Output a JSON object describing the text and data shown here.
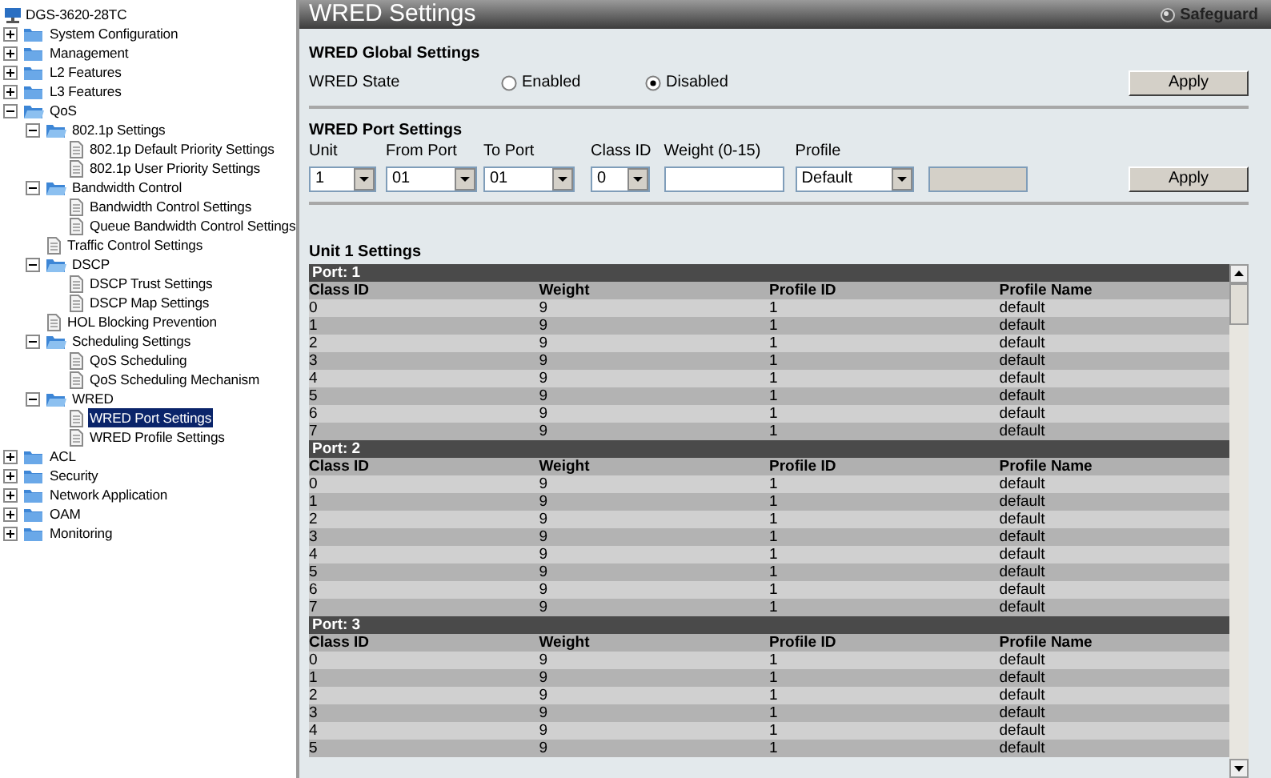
{
  "device": "DGS-3620-28TC",
  "tree": [
    {
      "label": "System Configuration",
      "kind": "folder",
      "expanded": false,
      "selected": false
    },
    {
      "label": "Management",
      "kind": "folder",
      "expanded": false,
      "selected": false
    },
    {
      "label": "L2 Features",
      "kind": "folder",
      "expanded": false,
      "selected": false
    },
    {
      "label": "L3 Features",
      "kind": "folder",
      "expanded": false,
      "selected": false
    },
    {
      "label": "QoS",
      "kind": "folder",
      "expanded": true,
      "selected": false,
      "children": [
        {
          "label": "802.1p Settings",
          "kind": "folder",
          "expanded": true,
          "selected": false,
          "children": [
            {
              "label": "802.1p Default Priority Settings",
              "kind": "page",
              "selected": false
            },
            {
              "label": "802.1p User Priority Settings",
              "kind": "page",
              "selected": false
            }
          ]
        },
        {
          "label": "Bandwidth Control",
          "kind": "folder",
          "expanded": true,
          "selected": false,
          "children": [
            {
              "label": "Bandwidth Control Settings",
              "kind": "page",
              "selected": false
            },
            {
              "label": "Queue Bandwidth Control Settings",
              "kind": "page",
              "selected": false
            }
          ]
        },
        {
          "label": "Traffic Control Settings",
          "kind": "page",
          "selected": false
        },
        {
          "label": "DSCP",
          "kind": "folder",
          "expanded": true,
          "selected": false,
          "children": [
            {
              "label": "DSCP Trust Settings",
              "kind": "page",
              "selected": false
            },
            {
              "label": "DSCP Map Settings",
              "kind": "page",
              "selected": false
            }
          ]
        },
        {
          "label": "HOL Blocking Prevention",
          "kind": "page",
          "selected": false
        },
        {
          "label": "Scheduling Settings",
          "kind": "folder",
          "expanded": true,
          "selected": false,
          "children": [
            {
              "label": "QoS Scheduling",
              "kind": "page",
              "selected": false
            },
            {
              "label": "QoS Scheduling Mechanism",
              "kind": "page",
              "selected": false
            }
          ]
        },
        {
          "label": "WRED",
          "kind": "folder",
          "expanded": true,
          "selected": false,
          "children": [
            {
              "label": "WRED Port Settings",
              "kind": "page",
              "selected": true
            },
            {
              "label": "WRED Profile Settings",
              "kind": "page",
              "selected": false
            }
          ]
        }
      ]
    },
    {
      "label": "ACL",
      "kind": "folder",
      "expanded": false,
      "selected": false
    },
    {
      "label": "Security",
      "kind": "folder",
      "expanded": false,
      "selected": false
    },
    {
      "label": "Network Application",
      "kind": "folder",
      "expanded": false,
      "selected": false
    },
    {
      "label": "OAM",
      "kind": "folder",
      "expanded": false,
      "selected": false
    },
    {
      "label": "Monitoring",
      "kind": "folder",
      "expanded": false,
      "selected": false
    }
  ],
  "title": "WRED Settings",
  "safeguard": "Safeguard",
  "global": {
    "heading": "WRED Global Settings",
    "state_label": "WRED State",
    "options": [
      {
        "label": "Enabled",
        "selected": false
      },
      {
        "label": "Disabled",
        "selected": true
      }
    ],
    "apply": "Apply"
  },
  "port_settings": {
    "heading": "WRED Port Settings",
    "fields": [
      {
        "label": "Unit",
        "kind": "select",
        "value": "1"
      },
      {
        "label": "From Port",
        "kind": "select",
        "value": "01"
      },
      {
        "label": "To Port",
        "kind": "select",
        "value": "01"
      },
      {
        "label": "Class ID",
        "kind": "select",
        "value": "0"
      },
      {
        "label": "Weight (0-15)",
        "kind": "input",
        "disabled": false
      },
      {
        "label": "Profile",
        "kind": "select",
        "value": "Default"
      },
      {
        "kind": "input",
        "disabled": true
      }
    ],
    "apply": "Apply"
  },
  "unit_heading": "Unit 1 Settings",
  "ports": [
    {
      "title": "Port: 1",
      "columns": [
        "Class ID",
        "Weight",
        "Profile ID",
        "Profile Name"
      ],
      "rows": [
        [
          "0",
          "9",
          "1",
          "default"
        ],
        [
          "1",
          "9",
          "1",
          "default"
        ],
        [
          "2",
          "9",
          "1",
          "default"
        ],
        [
          "3",
          "9",
          "1",
          "default"
        ],
        [
          "4",
          "9",
          "1",
          "default"
        ],
        [
          "5",
          "9",
          "1",
          "default"
        ],
        [
          "6",
          "9",
          "1",
          "default"
        ],
        [
          "7",
          "9",
          "1",
          "default"
        ]
      ]
    },
    {
      "title": "Port: 2",
      "columns": [
        "Class ID",
        "Weight",
        "Profile ID",
        "Profile Name"
      ],
      "rows": [
        [
          "0",
          "9",
          "1",
          "default"
        ],
        [
          "1",
          "9",
          "1",
          "default"
        ],
        [
          "2",
          "9",
          "1",
          "default"
        ],
        [
          "3",
          "9",
          "1",
          "default"
        ],
        [
          "4",
          "9",
          "1",
          "default"
        ],
        [
          "5",
          "9",
          "1",
          "default"
        ],
        [
          "6",
          "9",
          "1",
          "default"
        ],
        [
          "7",
          "9",
          "1",
          "default"
        ]
      ]
    },
    {
      "title": "Port: 3",
      "columns": [
        "Class ID",
        "Weight",
        "Profile ID",
        "Profile Name"
      ],
      "rows": [
        [
          "0",
          "9",
          "1",
          "default"
        ],
        [
          "1",
          "9",
          "1",
          "default"
        ],
        [
          "2",
          "9",
          "1",
          "default"
        ],
        [
          "3",
          "9",
          "1",
          "default"
        ],
        [
          "4",
          "9",
          "1",
          "default"
        ],
        [
          "5",
          "9",
          "1",
          "default"
        ]
      ]
    }
  ]
}
